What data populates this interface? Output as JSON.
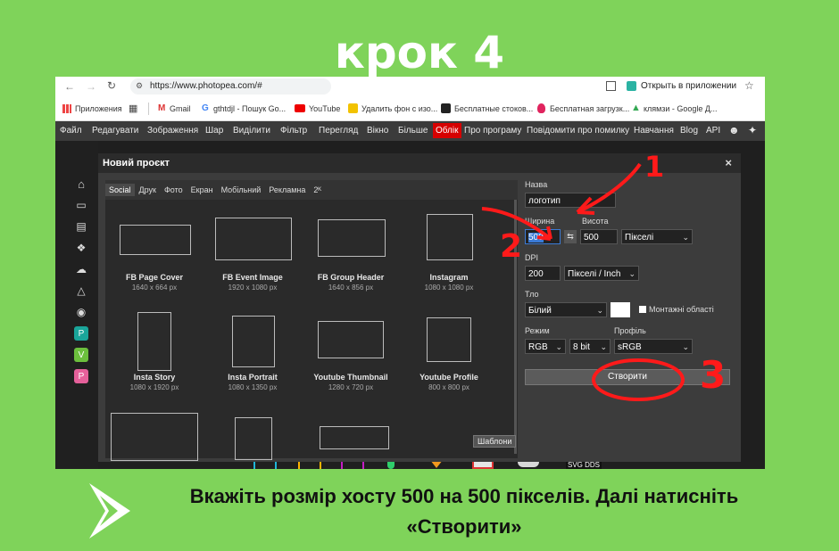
{
  "heading": "крок 4",
  "browser": {
    "url": "https://www.photopea.com/#",
    "open_in_app": "Открыть в приложении",
    "bookmarks": [
      "Приложения",
      "Gmail",
      "gthtdjl - Пошук Go...",
      "YouTube",
      "Удалить фон с изо...",
      "Бесплатные стоков...",
      "Бесплатная загрузк...",
      "клямзи - Google Д..."
    ]
  },
  "menu": [
    "Файл",
    "Редагувати",
    "Зображення",
    "Шар",
    "Виділити",
    "Фільтр",
    "Перегляд",
    "Вікно",
    "Більше",
    "Облік",
    "Про програму",
    "Повідомити про помилку",
    "Навчання",
    "Blog",
    "API"
  ],
  "dialog": {
    "title": "Новий проєкт",
    "close": "×",
    "tabs": [
      "Social",
      "Друк",
      "Фото",
      "Екран",
      "Мобільний",
      "Рекламна",
      "2ᴷ"
    ],
    "presets": [
      {
        "name": "FB Page Cover",
        "size": "1640 x 664 px"
      },
      {
        "name": "FB Event Image",
        "size": "1920 x 1080 px"
      },
      {
        "name": "FB Group Header",
        "size": "1640 x 856 px"
      },
      {
        "name": "Instagram",
        "size": "1080 x 1080 px"
      },
      {
        "name": "Insta Story",
        "size": "1080 x 1920 px"
      },
      {
        "name": "Insta Portrait",
        "size": "1080 x 1350 px"
      },
      {
        "name": "Youtube Thumbnail",
        "size": "1280 x 720 px"
      },
      {
        "name": "Youtube Profile",
        "size": "800 x 800 px"
      }
    ],
    "templates_button": "Шаблони",
    "form": {
      "name_label": "Назва",
      "name_value": "логотип",
      "width_label": "Ширина",
      "height_label": "Висота",
      "width_value": "500",
      "height_value": "500",
      "unit_value": "Пікселі",
      "dpi_label": "DPI",
      "dpi_value": "200",
      "dpi_unit": "Пікселі / Inch",
      "bg_label": "Тло",
      "bg_value": "Білий",
      "artboards_label": "Монтажні області",
      "mode_label": "Режим",
      "profile_label": "Профіль",
      "mode_value": "RGB",
      "bits_value": "8 bit",
      "profile_value": "sRGB",
      "create_button": "Створити"
    }
  },
  "annotations": [
    "1",
    "2",
    "3"
  ],
  "instruction": "Вкажіть розмір хосту 500 на 500 пікселів. Далі натисніть «Створити»",
  "colors": {
    "background": "#7fd35a",
    "annotation": "#ff1a1a",
    "heading": "#ffffff"
  }
}
